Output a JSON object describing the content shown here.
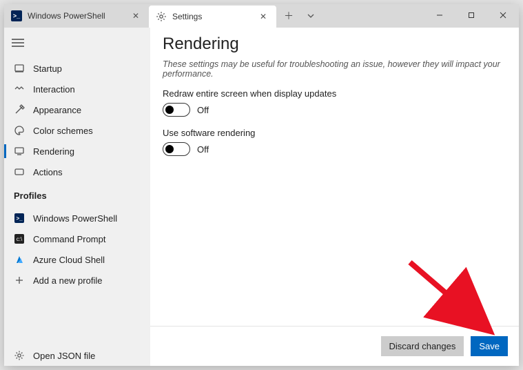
{
  "tabs": {
    "inactive": {
      "label": "Windows PowerShell"
    },
    "active": {
      "label": "Settings"
    }
  },
  "sidebar": {
    "items": [
      {
        "label": "Startup"
      },
      {
        "label": "Interaction"
      },
      {
        "label": "Appearance"
      },
      {
        "label": "Color schemes"
      },
      {
        "label": "Rendering"
      },
      {
        "label": "Actions"
      }
    ],
    "profilesHeader": "Profiles",
    "profiles": [
      {
        "label": "Windows PowerShell"
      },
      {
        "label": "Command Prompt"
      },
      {
        "label": "Azure Cloud Shell"
      },
      {
        "label": "Add a new profile"
      }
    ],
    "openJson": "Open JSON file"
  },
  "page": {
    "title": "Rendering",
    "subtitle": "These settings may be useful for troubleshooting an issue, however they will impact your performance.",
    "setting1": {
      "label": "Redraw entire screen when display updates",
      "state": "Off"
    },
    "setting2": {
      "label": "Use software rendering",
      "state": "Off"
    }
  },
  "footer": {
    "discard": "Discard changes",
    "save": "Save"
  }
}
